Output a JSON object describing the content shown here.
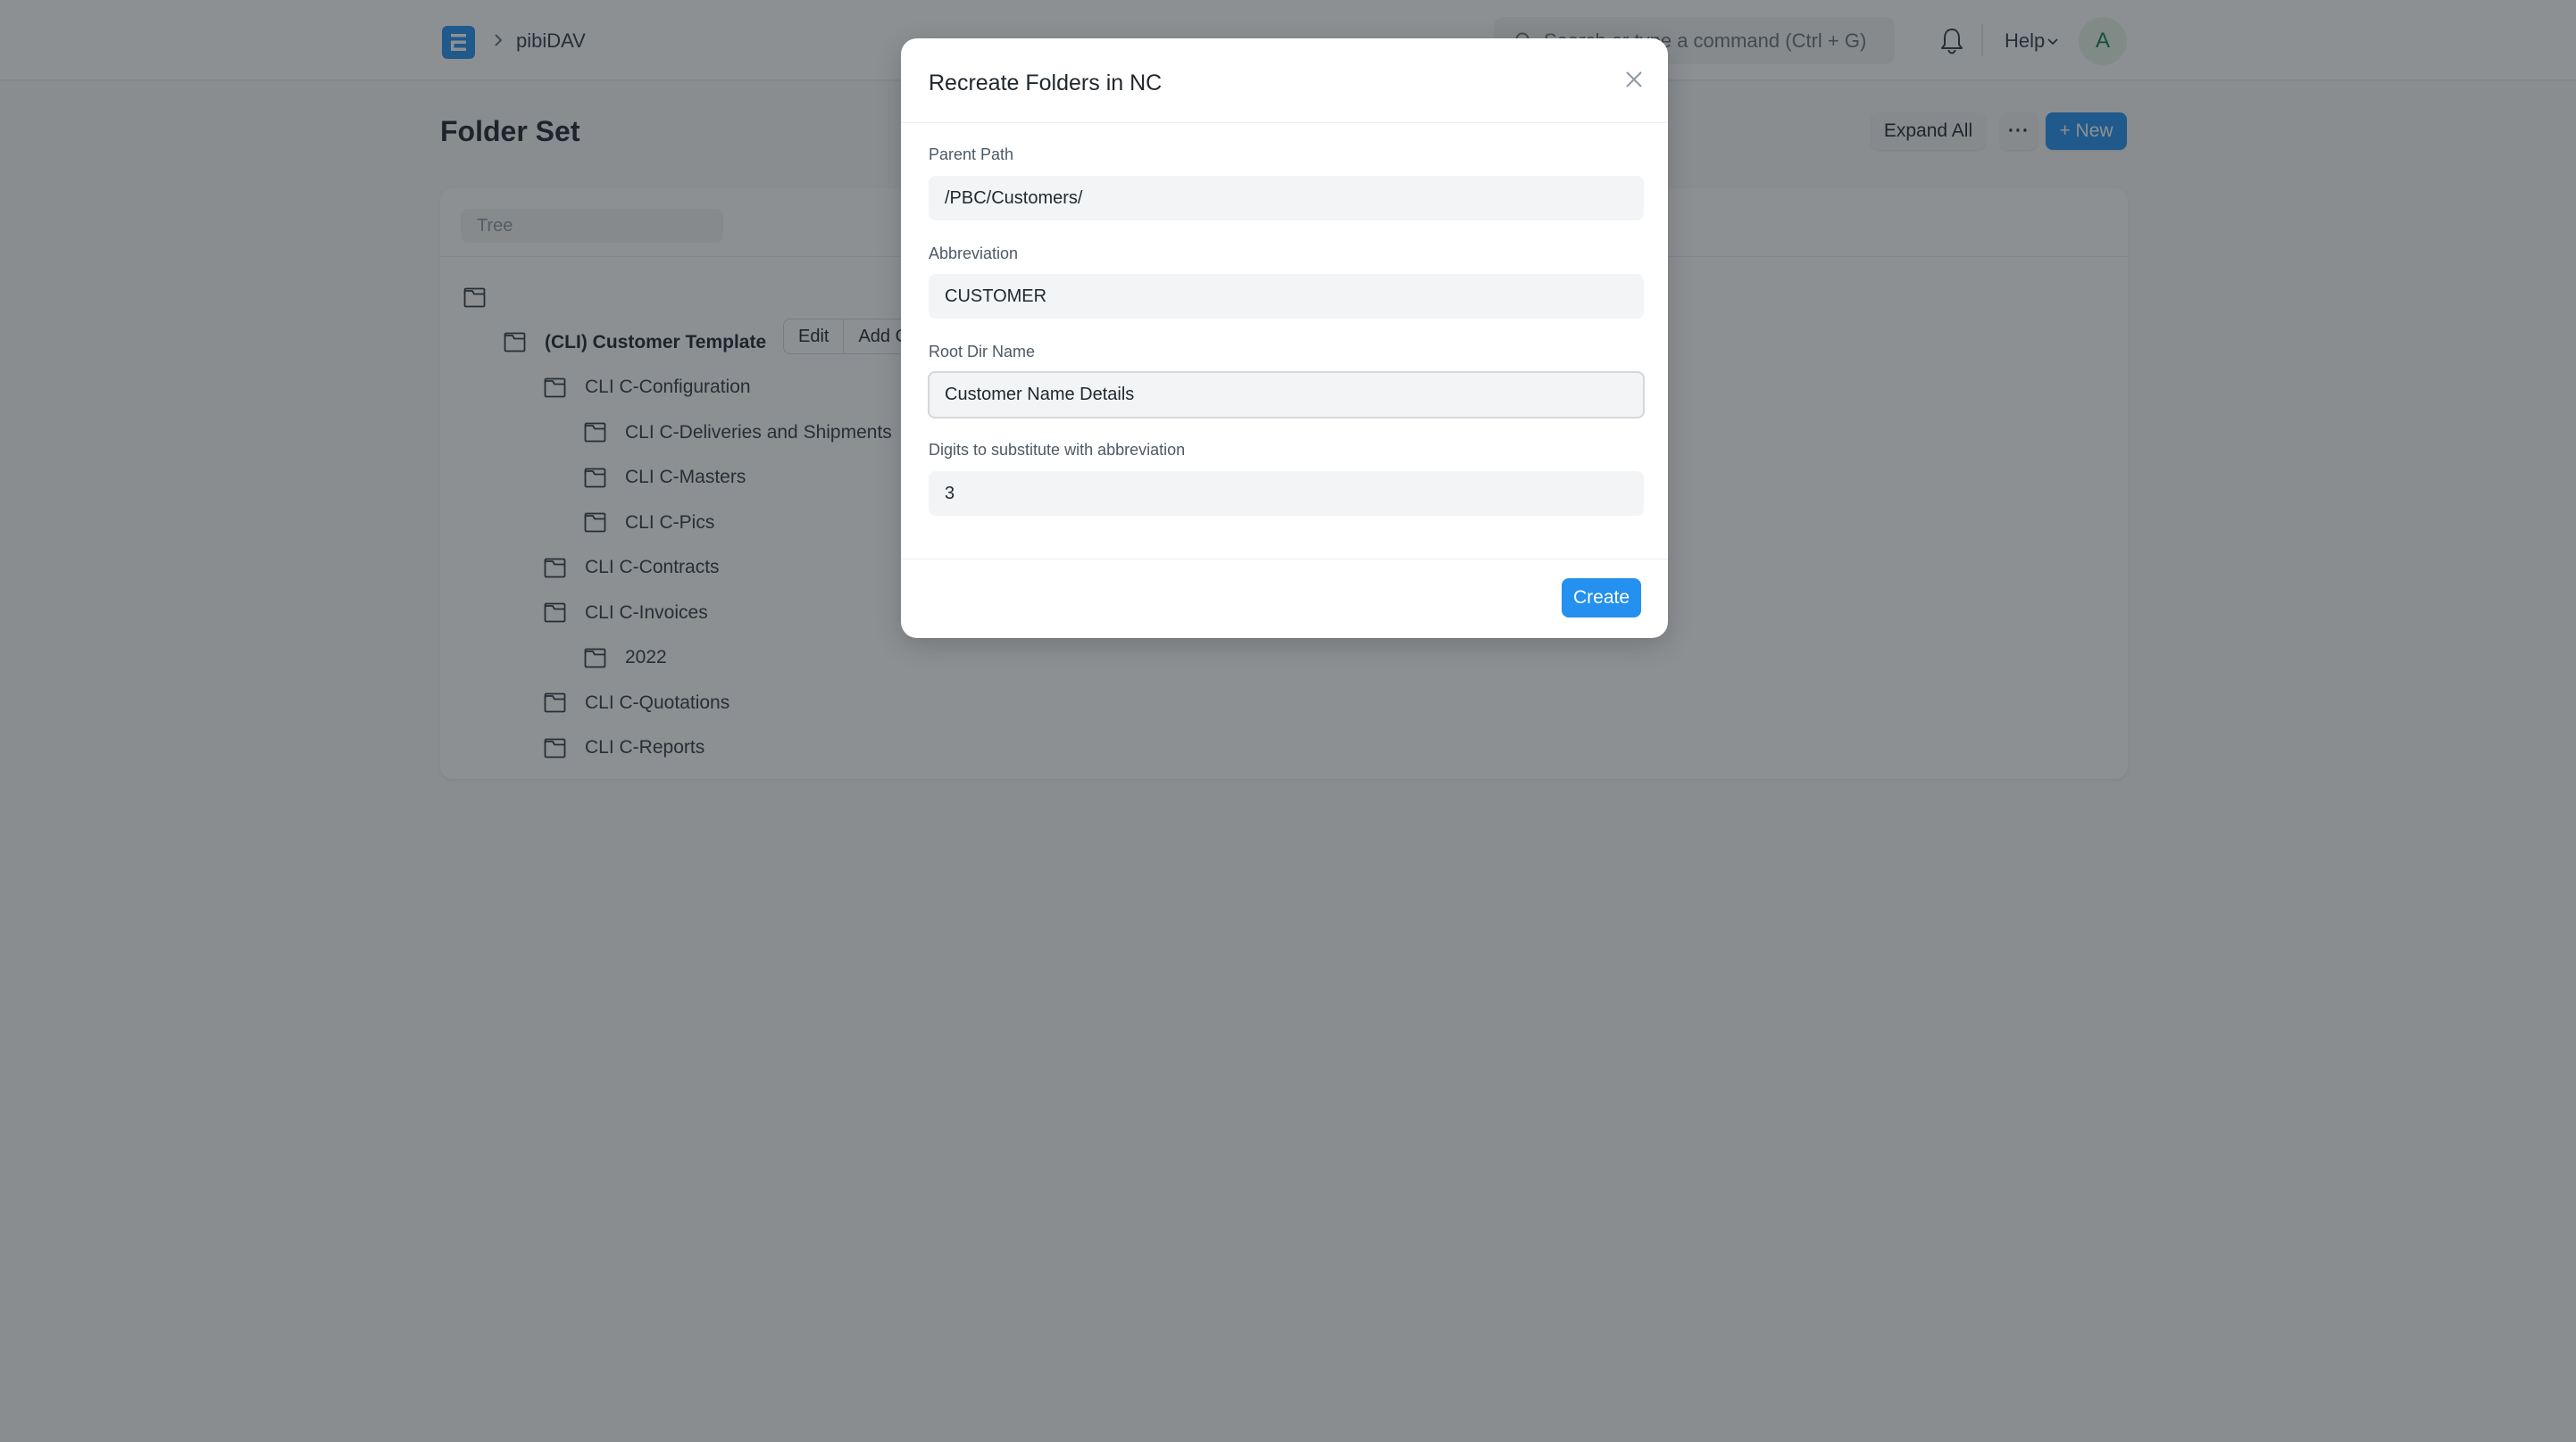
{
  "navbar": {
    "app_logo_letter": "E",
    "breadcrumb": [
      "pibiDAV"
    ],
    "search_placeholder": "Search or type a command (Ctrl + G)",
    "help_label": "Help",
    "avatar_initial": "A"
  },
  "page": {
    "title": "Folder Set",
    "actions": {
      "expand_all": "Expand All",
      "more": "···",
      "new": "+ New"
    }
  },
  "tree": {
    "filter_placeholder": "Tree",
    "node_actions": [
      "Edit",
      "Add C"
    ],
    "nodes": [
      {
        "label": "",
        "level": 0
      },
      {
        "label": "(CLI) Customer Template",
        "level": 1
      },
      {
        "label": "CLI C-Configuration",
        "level": 2
      },
      {
        "label": "CLI C-Deliveries and Shipments",
        "level": 3
      },
      {
        "label": "CLI C-Masters",
        "level": 3
      },
      {
        "label": "CLI C-Pics",
        "level": 3
      },
      {
        "label": "CLI C-Contracts",
        "level": 2
      },
      {
        "label": "CLI C-Invoices",
        "level": 2
      },
      {
        "label": "2022",
        "level": 3
      },
      {
        "label": "CLI C-Quotations",
        "level": 2
      },
      {
        "label": "CLI C-Reports",
        "level": 2
      }
    ]
  },
  "dialog": {
    "title": "Recreate Folders in NC",
    "fields": [
      {
        "label": "Parent Path",
        "value": "/PBC/Customers/"
      },
      {
        "label": "Abbreviation",
        "value": "CUSTOMER"
      },
      {
        "label": "Root Dir Name",
        "value": "Customer Name Details",
        "focused": true
      },
      {
        "label": "Digits to substitute with abbreviation",
        "value": "3"
      }
    ],
    "primary_action": "Create"
  },
  "colors": {
    "primary": "#2490ef",
    "avatar_bg": "#e4f5e9",
    "avatar_fg": "#16794c"
  }
}
